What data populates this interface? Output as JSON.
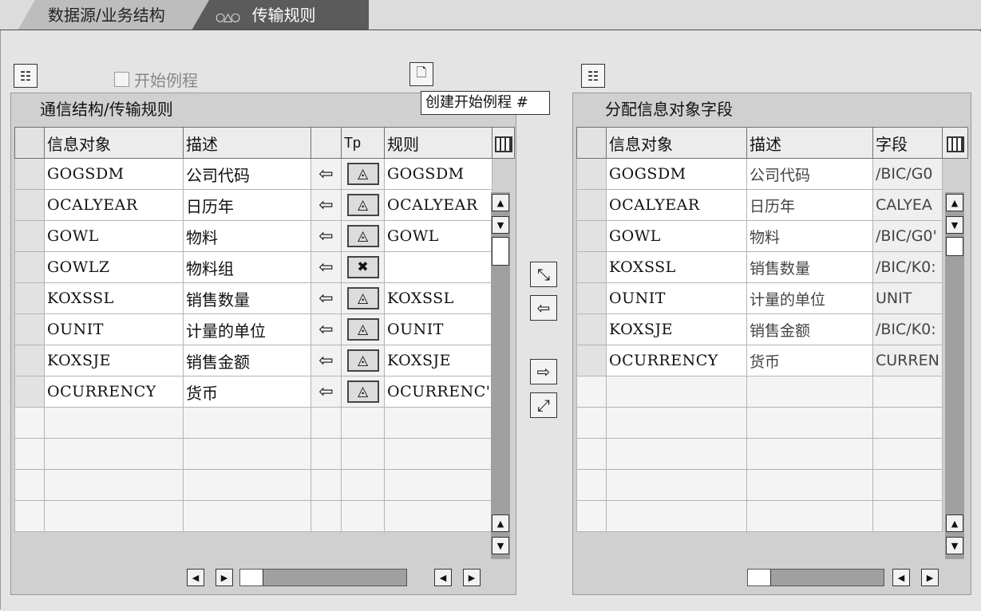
{
  "tabs": [
    {
      "label": "数据源/业务结构"
    },
    {
      "label": "传输规则",
      "icon": "o-triangle-o-icon"
    }
  ],
  "toolbar": {
    "start_routine_checkbox": "开始例程",
    "tooltip": "创建开始例程 #"
  },
  "left_panel": {
    "title": "通信结构/传输规则",
    "columns": [
      "信息对象",
      "描述",
      "",
      "Tp",
      "规则"
    ],
    "rows": [
      {
        "info": "GOGSDM",
        "desc": "公司代码",
        "arrow": "⇦",
        "tp": "◬",
        "rule": "GOGSDM"
      },
      {
        "info": "OCALYEAR",
        "desc": "日历年",
        "arrow": "⇦",
        "tp": "◬",
        "rule": "OCALYEAR"
      },
      {
        "info": "GOWL",
        "desc": "物料",
        "arrow": "⇦",
        "tp": "◬",
        "rule": "GOWL"
      },
      {
        "info": "GOWLZ",
        "desc": "物料组",
        "arrow": "⇦",
        "tp": "✖",
        "rule": ""
      },
      {
        "info": "KOXSSL",
        "desc": "销售数量",
        "arrow": "⇦",
        "tp": "◬",
        "rule": "KOXSSL"
      },
      {
        "info": "OUNIT",
        "desc": "计量的单位",
        "arrow": "⇦",
        "tp": "◬",
        "rule": "OUNIT"
      },
      {
        "info": "KOXSJE",
        "desc": "销售金额",
        "arrow": "⇦",
        "tp": "◬",
        "rule": "KOXSJE"
      },
      {
        "info": "OCURRENCY",
        "desc": "货币",
        "arrow": "⇦",
        "tp": "◬",
        "rule": "OCURRENC'"
      }
    ]
  },
  "right_panel": {
    "title": "分配信息对象字段",
    "columns": [
      "信息对象",
      "描述",
      "字段"
    ],
    "rows": [
      {
        "info": "GOGSDM",
        "desc": "公司代码",
        "field": "/BIC/G0"
      },
      {
        "info": "OCALYEAR",
        "desc": "日历年",
        "field": "CALYEA"
      },
      {
        "info": "GOWL",
        "desc": "物料",
        "field": "/BIC/G0'"
      },
      {
        "info": "KOXSSL",
        "desc": "销售数量",
        "field": "/BIC/K0:"
      },
      {
        "info": "OUNIT",
        "desc": "计量的单位",
        "field": "UNIT"
      },
      {
        "info": "KOXSJE",
        "desc": "销售金额",
        "field": "/BIC/K0:"
      },
      {
        "info": "OCURRENCY",
        "desc": "货币",
        "field": "CURREN"
      }
    ]
  },
  "middle_buttons": [
    "⇦",
    "⇨"
  ]
}
